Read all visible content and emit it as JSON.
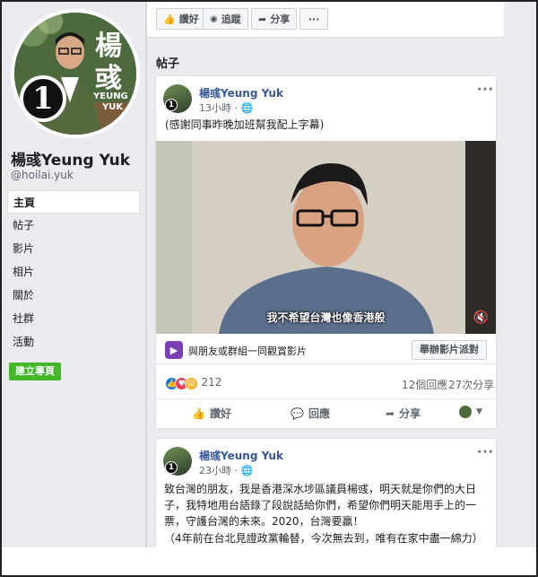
{
  "profile": {
    "name": "楊彧Yeung Yuk",
    "handle": "@hoilai.yuk",
    "avatar_text_top": "楊",
    "avatar_text_mid": "彧",
    "avatar_text_en": "YEUNG",
    "avatar_text_en2": "YUK",
    "badge_number": "1"
  },
  "nav": {
    "items": [
      "主頁",
      "帖子",
      "影片",
      "相片",
      "關於",
      "社群",
      "活動"
    ],
    "create_page": "建立專頁"
  },
  "toolbar": {
    "like": "讚好",
    "follow": "追蹤",
    "share": "分享",
    "more": "···"
  },
  "section_title": "帖子",
  "posts": [
    {
      "author": "楊彧Yeung Yuk",
      "time": "13小時 ·",
      "text": "(感謝同事昨晚加班幫我配上字幕)",
      "video_subtitle": "我不希望台灣也像香港般",
      "watch_text": "與朋友或群組一同觀賞影片",
      "watch_party": "舉辦影片派對",
      "reaction_count": "212",
      "comments": "12個回應",
      "shares": "27次分享",
      "action_like": "讚好",
      "action_comment": "回應",
      "action_share": "分享"
    },
    {
      "author": "楊彧Yeung Yuk",
      "time": "23小時 ·",
      "line1": "致台灣的朋友，我是香港深水埗區議員楊彧，明天就是你們的大日",
      "line2": "子，我特地用台語錄了段說話給你們，希望你們明天能用手上的一",
      "line3": "票，守護台灣的未來。2020，台灣要贏！",
      "line4": "（4年前在台北見證政黨輪替，今次無去到，唯有在家中盡一綿力）"
    }
  ],
  "colors": {
    "link": "#385898",
    "green": "#42b72a",
    "background": "#e9ebee"
  }
}
